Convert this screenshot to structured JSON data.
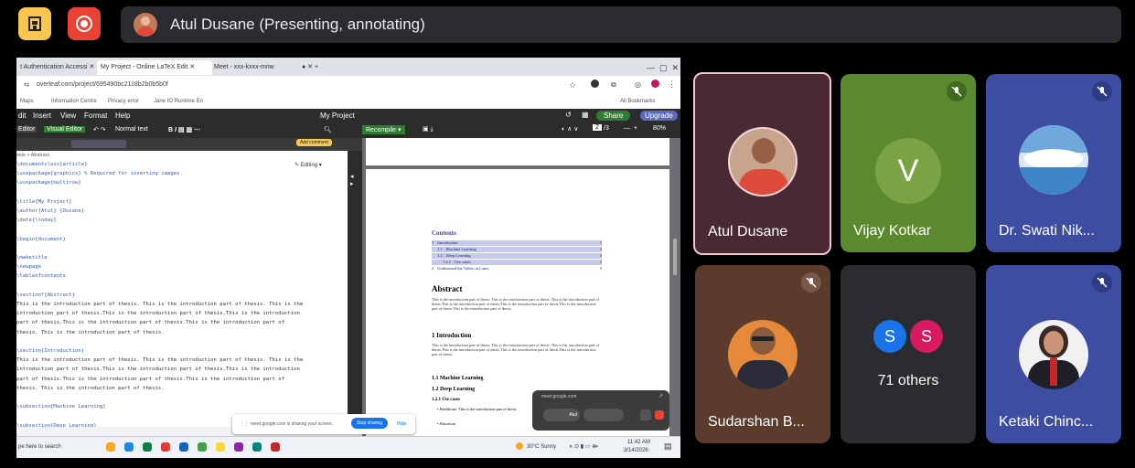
{
  "topbar": {
    "presenter_label": "Atul Dusane (Presenting, annotating)"
  },
  "browser": {
    "tabs": [
      "t Authentication Accessi",
      "My Project - Online LaTeX Edit",
      "Meet - xxx-kxxx-mnw"
    ],
    "url": "overleaf.com/project/695490bc2118b2b0b5b0f",
    "bookmarks": [
      "Maps",
      "Information Centre",
      "Privacy error",
      "Jane IO Runtime En",
      "All Bookmarks"
    ]
  },
  "overleaf": {
    "menu": [
      "dit",
      "Insert",
      "View",
      "Format",
      "Help"
    ],
    "project_title": "My Project",
    "share_label": "Share",
    "upgrade_label": "Upgrade",
    "editor_tabs": [
      "Editor",
      "Visual Editor"
    ],
    "style_select": "Normal text",
    "add_comment_label": "Add comment",
    "breadcrumb": "esis > Abstract",
    "editing_label": "Editing",
    "recompile_label": "Recompile",
    "page_current": "2",
    "page_total": "/3",
    "zoom": "80%",
    "editor_lines": [
      "\\documentclass{article}",
      "\\usepackage{graphicx} % Required for inserting images",
      "\\usepackage{multirow}",
      "",
      "\\title{My Project}",
      "\\author{Atul} {Dusane}",
      "\\date{\\today}",
      "",
      "\\begin{document}",
      "",
      "\\maketitle",
      "\\newpage",
      "\\tableofcontents",
      "",
      "\\section*{Abstract}",
      "This is the introduction part of thesis. This is the introduction part of thesis. This is the",
      "introduction part of thesis.This is the introduction part of thesis.This is the introduction",
      "part of thesis.This is the introduction part of thesis.This is the introduction part of",
      "thesis. This is the introduction part of thesis.",
      "",
      "\\section{Introduction}",
      "This is the introduction part of thesis. This is the introduction part of thesis. This is the",
      "introduction part of thesis.This is the introduction part of thesis.This is the introduction",
      "part of thesis.This is the introduction part of thesis.This is the introduction part of",
      "thesis. This is the introduction part of thesis.",
      "",
      "\\subsection{Machine Learning}",
      "",
      "\\subsection{Deep Learning}"
    ],
    "pdf": {
      "contents_heading": "Contents",
      "toc": [
        {
          "num": "1",
          "text": "Introduction",
          "page": "3"
        },
        {
          "num": "1.1",
          "text": "Machine Learning",
          "page": "3"
        },
        {
          "num": "1.2",
          "text": "Deep Learning",
          "page": "3"
        },
        {
          "num": "1.2.1",
          "text": "Use cases",
          "page": "3"
        },
        {
          "num": "2",
          "text": "Understand the Tables in Latex",
          "page": "3"
        }
      ],
      "abstract_heading": "Abstract",
      "abstract_text": "This is the introduction part of thesis. This is the introduction part of thesis. This is the introduction part of thesis.This is the introduction part of thesis.This is the introduction part of thesis.This is the introduction part of thesis.This is the introduction part of thesis.",
      "intro_heading": "1   Introduction",
      "intro_text": "This is the introduction part of thesis. This is the introduction part of thesis. This is the introduction part of thesis.This is the introduction part of thesis.This is the introduction part of thesis.This is the introduction part of thesis.",
      "sub1": "1.1   Machine Learning",
      "sub2": "1.2   Deep Learning",
      "sub3": "1.2.1   Use cases",
      "bullet1": "Healthcare: This is the introduction part of thesis",
      "bullet2": "Education"
    }
  },
  "share_notice": {
    "text": "meet.google.com is sharing your screen.",
    "stop_label": "Stop sharing",
    "hide_label": "Hide"
  },
  "pip": {
    "title": "meet.google.com",
    "name": "Atul"
  },
  "taskbar": {
    "search": "pe here to search",
    "weather": "30°C Sunny",
    "time": "11:42 AM",
    "date": "3/14/2026"
  },
  "participants": [
    {
      "name": "Atul Dusane",
      "bg": "#4a2a32"
    },
    {
      "name": "Vijay Kotkar",
      "bg": "#5b8a2e",
      "initial": "V",
      "initial_bg": "#7aa344"
    },
    {
      "name": "Dr. Swati Nik...",
      "bg": "#3d4da1"
    },
    {
      "name": "Sudarshan B...",
      "bg": "#5a3b2c"
    },
    {
      "name": "71 others",
      "bg": "#2b2c2f",
      "others": [
        "S",
        "S"
      ]
    },
    {
      "name": "Ketaki Chinc...",
      "bg": "#3d4da1"
    }
  ],
  "colors": {
    "accent_green": "#4caf50",
    "accent_blue": "#1a73e8",
    "speaking_border": "#f0c8d0"
  }
}
